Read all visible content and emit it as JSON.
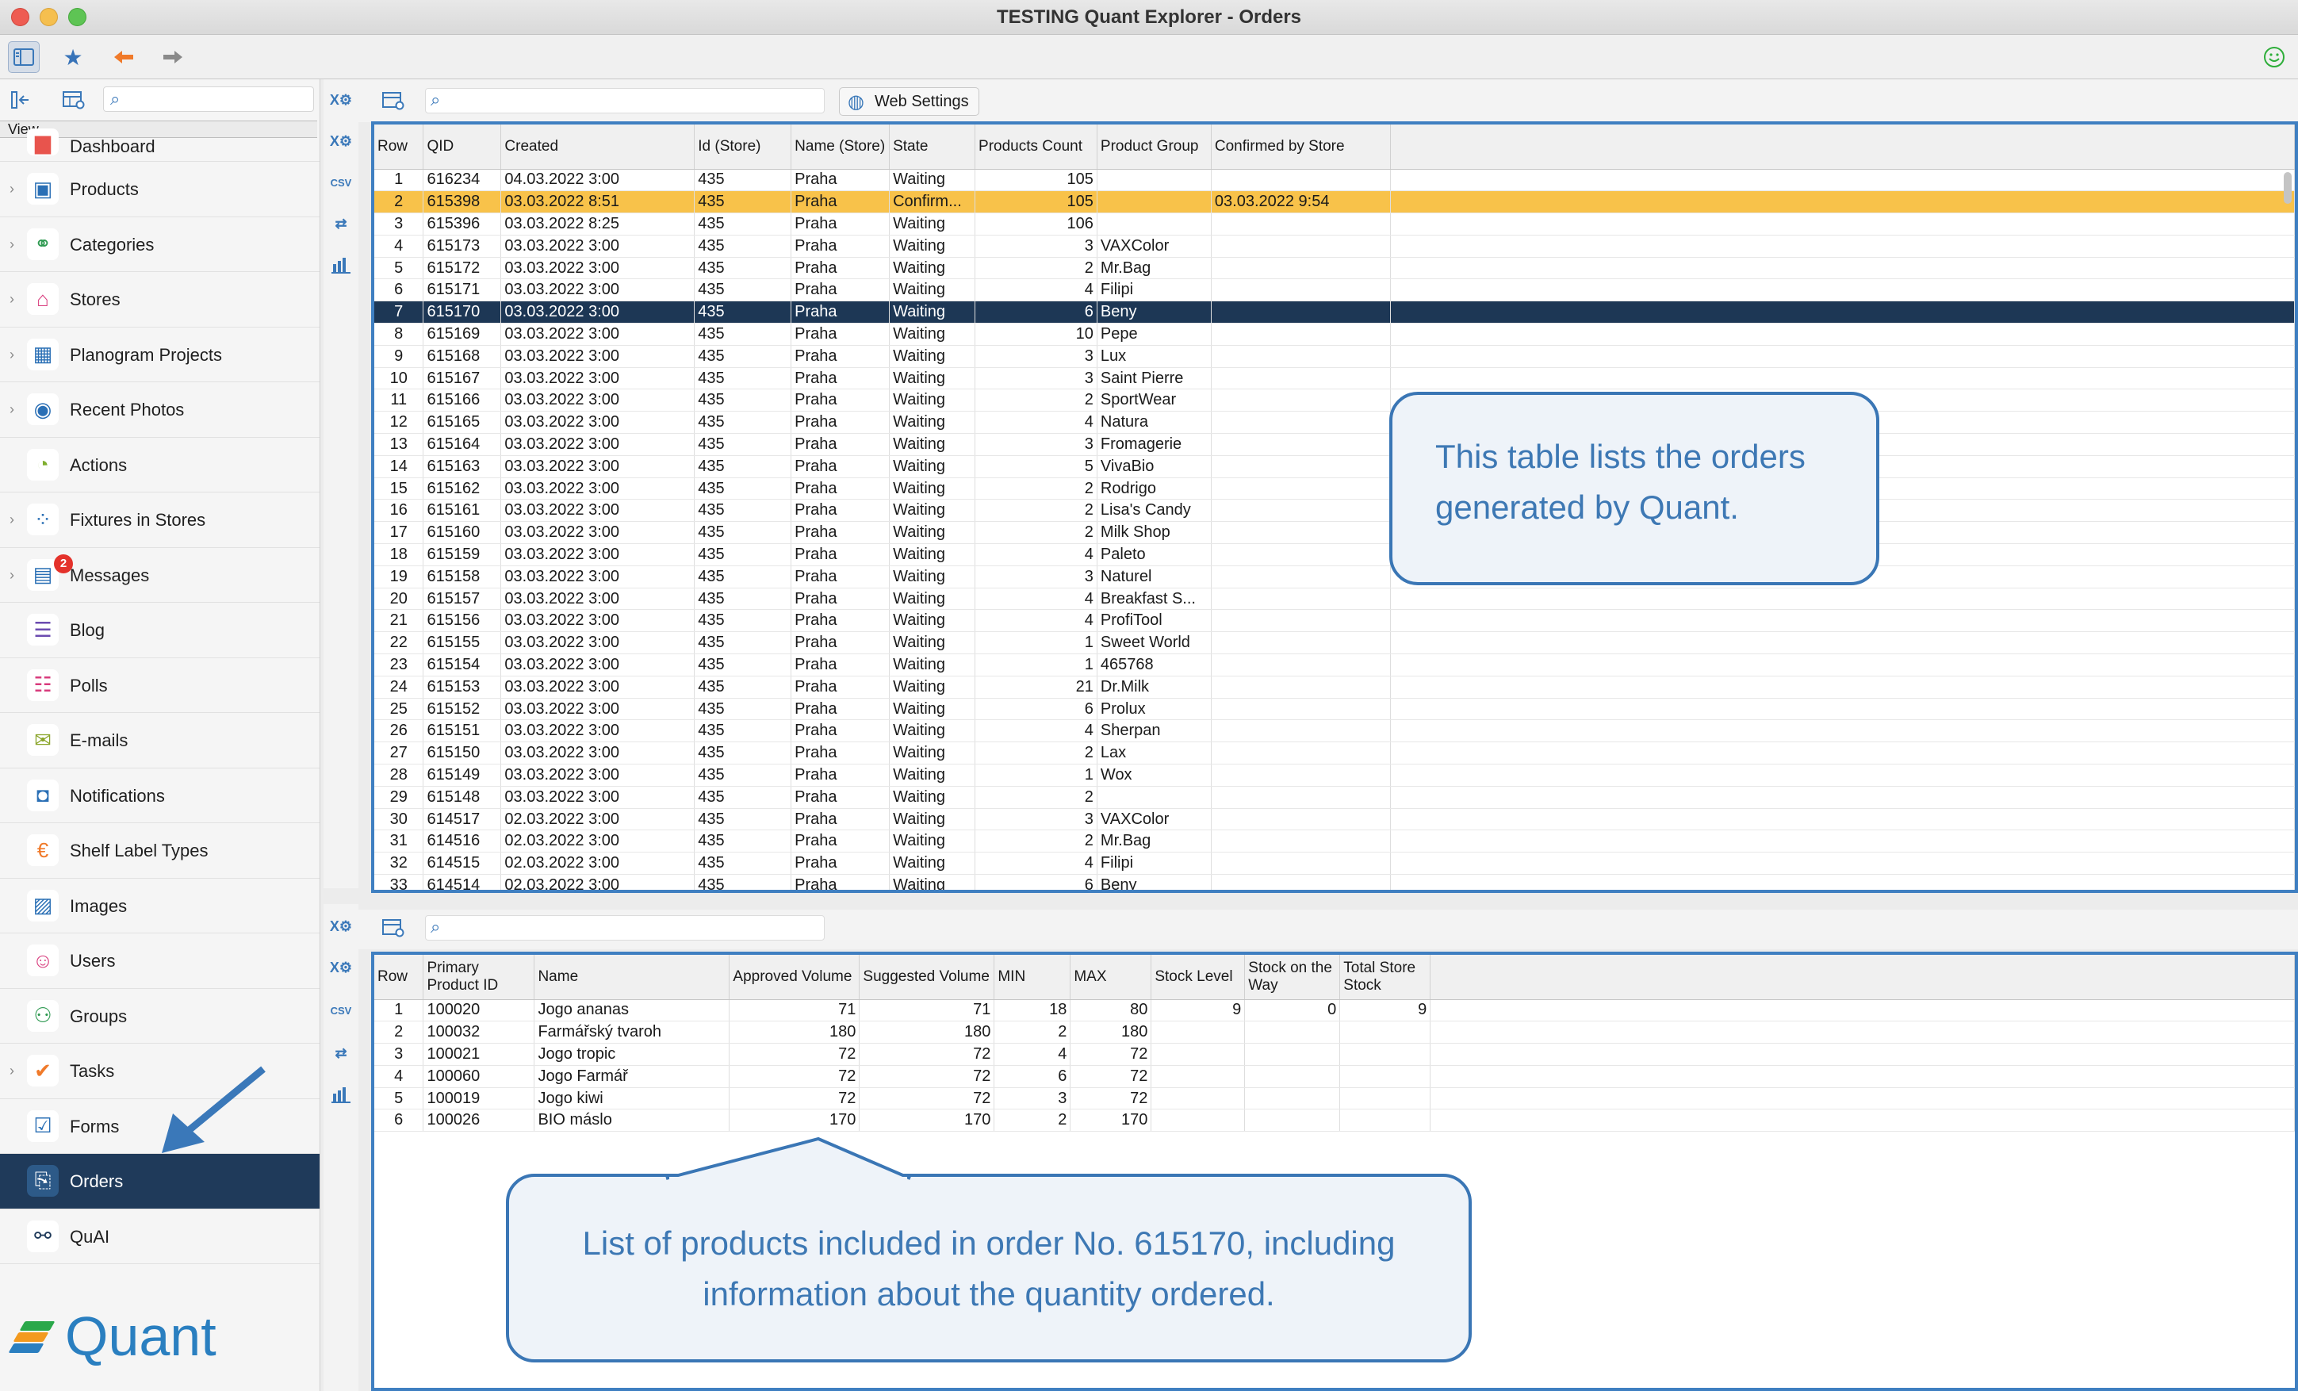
{
  "window": {
    "title": "TESTING Quant Explorer - Orders"
  },
  "toolbar": {
    "icons": [
      "sidebar-toggle-icon",
      "favorites-star-icon",
      "back-arrow-icon",
      "forward-arrow-icon",
      "feedback-smiley-icon"
    ]
  },
  "sidebar": {
    "search_placeholder": "",
    "view_label": "View",
    "items": [
      {
        "label": "Dashboard",
        "icon": "dashboard-icon",
        "expandable": false
      },
      {
        "label": "Products",
        "icon": "products-icon",
        "expandable": true
      },
      {
        "label": "Categories",
        "icon": "categories-icon",
        "expandable": true
      },
      {
        "label": "Stores",
        "icon": "stores-icon",
        "expandable": true
      },
      {
        "label": "Planogram Projects",
        "icon": "planogram-icon",
        "expandable": true
      },
      {
        "label": "Recent Photos",
        "icon": "camera-icon",
        "expandable": true
      },
      {
        "label": "Actions",
        "icon": "actions-icon",
        "expandable": false
      },
      {
        "label": "Fixtures in Stores",
        "icon": "fixtures-icon",
        "expandable": true
      },
      {
        "label": "Messages",
        "icon": "messages-icon",
        "expandable": true,
        "badge": "2"
      },
      {
        "label": "Blog",
        "icon": "blog-icon",
        "expandable": false
      },
      {
        "label": "Polls",
        "icon": "polls-icon",
        "expandable": false
      },
      {
        "label": "E-mails",
        "icon": "email-icon",
        "expandable": false
      },
      {
        "label": "Notifications",
        "icon": "notifications-icon",
        "expandable": false
      },
      {
        "label": "Shelf Label Types",
        "icon": "shelf-label-icon",
        "expandable": false
      },
      {
        "label": "Images",
        "icon": "images-icon",
        "expandable": false
      },
      {
        "label": "Users",
        "icon": "users-icon",
        "expandable": false
      },
      {
        "label": "Groups",
        "icon": "groups-icon",
        "expandable": false
      },
      {
        "label": "Tasks",
        "icon": "tasks-icon",
        "expandable": true
      },
      {
        "label": "Forms",
        "icon": "forms-icon",
        "expandable": false
      },
      {
        "label": "Orders",
        "icon": "orders-icon",
        "expandable": false,
        "active": true
      },
      {
        "label": "QuAI",
        "icon": "quai-icon",
        "expandable": false
      }
    ],
    "logo_text": "Quant"
  },
  "orders_panel": {
    "search_placeholder": "",
    "web_settings_label": "Web Settings",
    "columns": [
      "Row",
      "QID",
      "Created",
      "Id (Store)",
      "Name (Store)",
      "State",
      "Products Count",
      "Product Group",
      "Confirmed by Store"
    ],
    "rows": [
      [
        "1",
        "616234",
        "04.03.2022 3:00",
        "435",
        "Praha",
        "Waiting",
        "105",
        "",
        ""
      ],
      [
        "2",
        "615398",
        "03.03.2022 8:51",
        "435",
        "Praha",
        "Confirm...",
        "105",
        "",
        "03.03.2022 9:54"
      ],
      [
        "3",
        "615396",
        "03.03.2022 8:25",
        "435",
        "Praha",
        "Waiting",
        "106",
        "",
        ""
      ],
      [
        "4",
        "615173",
        "03.03.2022 3:00",
        "435",
        "Praha",
        "Waiting",
        "3",
        "VAXColor",
        ""
      ],
      [
        "5",
        "615172",
        "03.03.2022 3:00",
        "435",
        "Praha",
        "Waiting",
        "2",
        "Mr.Bag",
        ""
      ],
      [
        "6",
        "615171",
        "03.03.2022 3:00",
        "435",
        "Praha",
        "Waiting",
        "4",
        "Filipi",
        ""
      ],
      [
        "7",
        "615170",
        "03.03.2022 3:00",
        "435",
        "Praha",
        "Waiting",
        "6",
        "Beny",
        ""
      ],
      [
        "8",
        "615169",
        "03.03.2022 3:00",
        "435",
        "Praha",
        "Waiting",
        "10",
        "Pepe",
        ""
      ],
      [
        "9",
        "615168",
        "03.03.2022 3:00",
        "435",
        "Praha",
        "Waiting",
        "3",
        "Lux",
        ""
      ],
      [
        "10",
        "615167",
        "03.03.2022 3:00",
        "435",
        "Praha",
        "Waiting",
        "3",
        "Saint Pierre",
        ""
      ],
      [
        "11",
        "615166",
        "03.03.2022 3:00",
        "435",
        "Praha",
        "Waiting",
        "2",
        "SportWear",
        ""
      ],
      [
        "12",
        "615165",
        "03.03.2022 3:00",
        "435",
        "Praha",
        "Waiting",
        "4",
        "Natura",
        ""
      ],
      [
        "13",
        "615164",
        "03.03.2022 3:00",
        "435",
        "Praha",
        "Waiting",
        "3",
        "Fromagerie",
        ""
      ],
      [
        "14",
        "615163",
        "03.03.2022 3:00",
        "435",
        "Praha",
        "Waiting",
        "5",
        "VivaBio",
        ""
      ],
      [
        "15",
        "615162",
        "03.03.2022 3:00",
        "435",
        "Praha",
        "Waiting",
        "2",
        "Rodrigo",
        ""
      ],
      [
        "16",
        "615161",
        "03.03.2022 3:00",
        "435",
        "Praha",
        "Waiting",
        "2",
        "Lisa's Candy",
        ""
      ],
      [
        "17",
        "615160",
        "03.03.2022 3:00",
        "435",
        "Praha",
        "Waiting",
        "2",
        "Milk Shop",
        ""
      ],
      [
        "18",
        "615159",
        "03.03.2022 3:00",
        "435",
        "Praha",
        "Waiting",
        "4",
        "Paleto",
        ""
      ],
      [
        "19",
        "615158",
        "03.03.2022 3:00",
        "435",
        "Praha",
        "Waiting",
        "3",
        "Naturel",
        ""
      ],
      [
        "20",
        "615157",
        "03.03.2022 3:00",
        "435",
        "Praha",
        "Waiting",
        "4",
        "Breakfast S...",
        ""
      ],
      [
        "21",
        "615156",
        "03.03.2022 3:00",
        "435",
        "Praha",
        "Waiting",
        "4",
        "ProfiTool",
        ""
      ],
      [
        "22",
        "615155",
        "03.03.2022 3:00",
        "435",
        "Praha",
        "Waiting",
        "1",
        "Sweet World",
        ""
      ],
      [
        "23",
        "615154",
        "03.03.2022 3:00",
        "435",
        "Praha",
        "Waiting",
        "1",
        "465768",
        ""
      ],
      [
        "24",
        "615153",
        "03.03.2022 3:00",
        "435",
        "Praha",
        "Waiting",
        "21",
        "Dr.Milk",
        ""
      ],
      [
        "25",
        "615152",
        "03.03.2022 3:00",
        "435",
        "Praha",
        "Waiting",
        "6",
        "Prolux",
        ""
      ],
      [
        "26",
        "615151",
        "03.03.2022 3:00",
        "435",
        "Praha",
        "Waiting",
        "4",
        "Sherpan",
        ""
      ],
      [
        "27",
        "615150",
        "03.03.2022 3:00",
        "435",
        "Praha",
        "Waiting",
        "2",
        "Lax",
        ""
      ],
      [
        "28",
        "615149",
        "03.03.2022 3:00",
        "435",
        "Praha",
        "Waiting",
        "1",
        "Wox",
        ""
      ],
      [
        "29",
        "615148",
        "03.03.2022 3:00",
        "435",
        "Praha",
        "Waiting",
        "2",
        "",
        ""
      ],
      [
        "30",
        "614517",
        "02.03.2022 3:00",
        "435",
        "Praha",
        "Waiting",
        "3",
        "VAXColor",
        ""
      ],
      [
        "31",
        "614516",
        "02.03.2022 3:00",
        "435",
        "Praha",
        "Waiting",
        "2",
        "Mr.Bag",
        ""
      ],
      [
        "32",
        "614515",
        "02.03.2022 3:00",
        "435",
        "Praha",
        "Waiting",
        "4",
        "Filipi",
        ""
      ],
      [
        "33",
        "614514",
        "02.03.2022 3:00",
        "435",
        "Praha",
        "Waiting",
        "6",
        "Beny",
        ""
      ]
    ],
    "highlight_yellow_row": 2,
    "selected_row": 7
  },
  "products_panel": {
    "search_placeholder": "",
    "columns": [
      "Row",
      "Primary Product ID",
      "Name",
      "Approved Volume",
      "Suggested Volume",
      "MIN",
      "MAX",
      "Stock Level",
      "Stock on the Way",
      "Total Store Stock"
    ],
    "rows": [
      [
        "1",
        "100020",
        "Jogo ananas",
        "71",
        "71",
        "18",
        "80",
        "9",
        "0",
        "9"
      ],
      [
        "2",
        "100032",
        "Farmářský tvaroh",
        "180",
        "180",
        "2",
        "180",
        "",
        "",
        ""
      ],
      [
        "3",
        "100021",
        "Jogo tropic",
        "72",
        "72",
        "4",
        "72",
        "",
        "",
        ""
      ],
      [
        "4",
        "100060",
        "Jogo Farmář",
        "72",
        "72",
        "6",
        "72",
        "",
        "",
        ""
      ],
      [
        "5",
        "100019",
        "Jogo kiwi",
        "72",
        "72",
        "3",
        "72",
        "",
        "",
        ""
      ],
      [
        "6",
        "100026",
        "BIO máslo",
        "170",
        "170",
        "2",
        "170",
        "",
        "",
        ""
      ]
    ]
  },
  "callouts": {
    "orders": "This table lists the orders generated by Quant.",
    "products": "List of products included in order No. 615170, including information about the quantity ordered."
  },
  "colors": {
    "accent": "#3f7fc1",
    "selected_row": "#1d3755",
    "confirmed_row": "#f8c24a",
    "badge": "#e4322b"
  }
}
